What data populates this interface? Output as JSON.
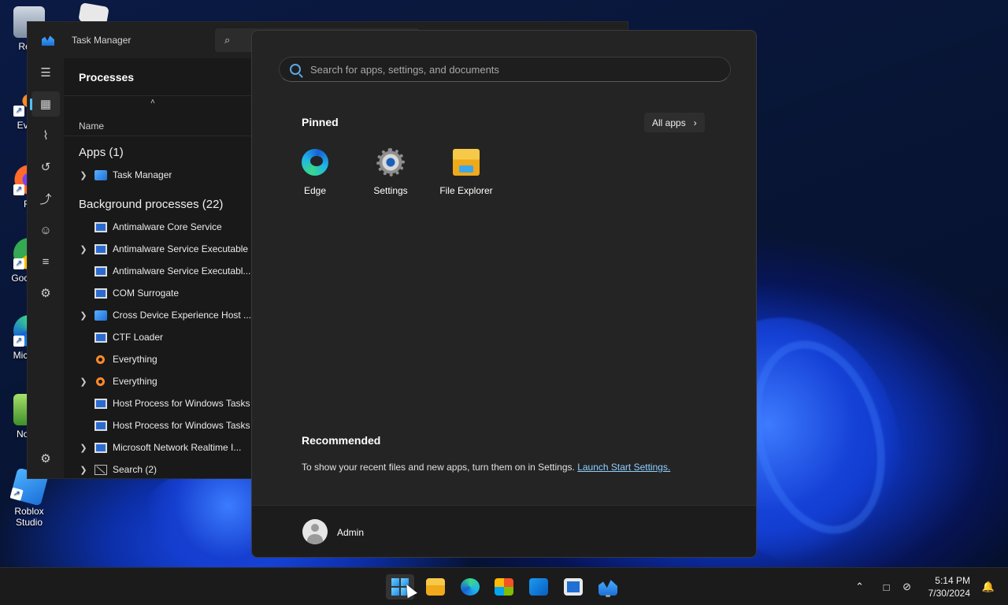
{
  "desktop": {
    "icons": [
      {
        "label": "Recy",
        "name": "recycle-bin"
      },
      {
        "label": "Every",
        "name": "everything"
      },
      {
        "label": "Fir",
        "name": "firefox"
      },
      {
        "label": "Goo Chr",
        "name": "google-chrome"
      },
      {
        "label": "Micr Ed",
        "name": "microsoft-edge"
      },
      {
        "label": "Notep",
        "name": "notepad"
      },
      {
        "label": "Roblox Studio",
        "name": "roblox-studio"
      }
    ]
  },
  "task_manager": {
    "title": "Task Manager",
    "page_title": "Processes",
    "column_name": "Name",
    "apps_group": "Apps (1)",
    "apps": [
      {
        "name": "Task Manager",
        "icon": "task-manager-icon",
        "expandable": true
      }
    ],
    "background_group": "Background processes (22)",
    "processes": [
      {
        "name": "Antimalware Core Service",
        "icon": "win",
        "expandable": false
      },
      {
        "name": "Antimalware Service Executable",
        "icon": "win",
        "expandable": true
      },
      {
        "name": "Antimalware Service Executabl...",
        "icon": "win",
        "expandable": false
      },
      {
        "name": "COM Surrogate",
        "icon": "win",
        "expandable": false
      },
      {
        "name": "Cross Device Experience Host ...",
        "icon": "cross",
        "expandable": true
      },
      {
        "name": "CTF Loader",
        "icon": "win",
        "expandable": false
      },
      {
        "name": "Everything",
        "icon": "magnifier",
        "expandable": false
      },
      {
        "name": "Everything",
        "icon": "magnifier",
        "expandable": true
      },
      {
        "name": "Host Process for Windows Tasks",
        "icon": "win",
        "expandable": false
      },
      {
        "name": "Host Process for Windows Tasks",
        "icon": "win",
        "expandable": false
      },
      {
        "name": "Microsoft Network Realtime I...",
        "icon": "win",
        "expandable": true
      },
      {
        "name": "Search (2)",
        "icon": "search",
        "expandable": true
      }
    ],
    "nav": [
      "menu-icon",
      "processes-icon",
      "performance-icon",
      "app-history-icon",
      "startup-apps-icon",
      "users-icon",
      "details-icon",
      "services-icon",
      "settings-icon"
    ]
  },
  "start_menu": {
    "search_placeholder": "Search for apps, settings, and documents",
    "pinned_title": "Pinned",
    "all_apps_label": "All apps",
    "pinned_apps": [
      {
        "label": "Edge",
        "icon": "edge-icon"
      },
      {
        "label": "Settings",
        "icon": "settings-icon"
      },
      {
        "label": "File Explorer",
        "icon": "file-explorer-icon"
      }
    ],
    "recommended_title": "Recommended",
    "recommended_text": "To show your recent files and new apps, turn them on in Settings.",
    "recommended_link": "Launch Start Settings.",
    "user_name": "Admin"
  },
  "taskbar": {
    "time": "5:14 PM",
    "date": "7/30/2024",
    "colors": {
      "accent": "#4cc2ff",
      "link": "#8fd0ff"
    }
  }
}
